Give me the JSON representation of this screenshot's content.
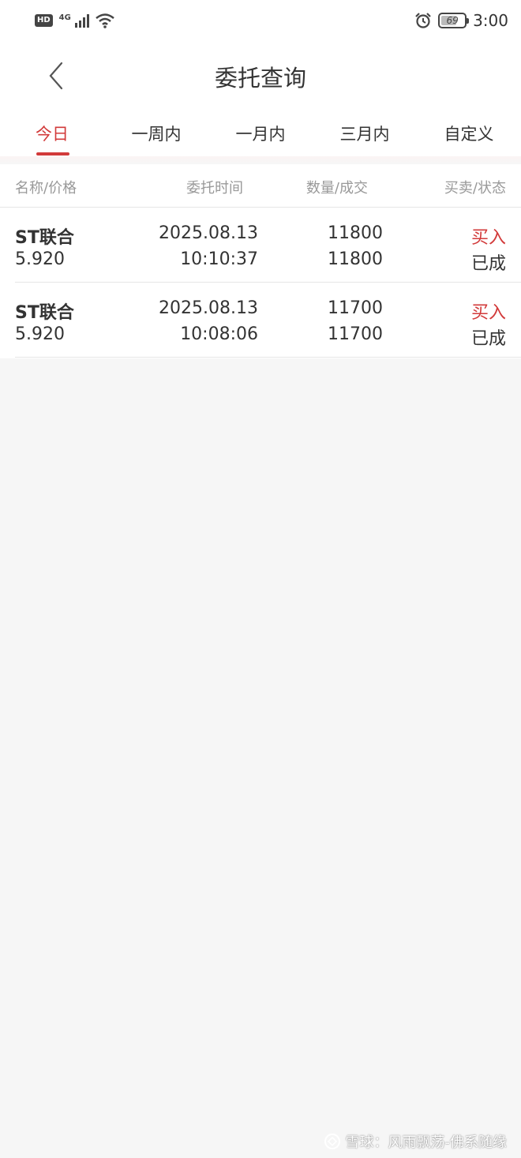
{
  "status_bar": {
    "hd": "HD",
    "network": "4G",
    "battery": "69",
    "battery_level_percent": 69,
    "time": "3:00",
    "icons": [
      "signal-icon",
      "wifi-icon",
      "alarm-icon",
      "battery-icon"
    ]
  },
  "header": {
    "title": "委托查询",
    "back_icon": "chevron-left-icon"
  },
  "tabs": [
    {
      "label": "今日",
      "active": true
    },
    {
      "label": "一周内",
      "active": false
    },
    {
      "label": "一月内",
      "active": false
    },
    {
      "label": "三月内",
      "active": false
    },
    {
      "label": "自定义",
      "active": false
    }
  ],
  "columns": {
    "name_price": "名称/价格",
    "time": "委托时间",
    "qty": "数量/成交",
    "side_status": "买卖/状态"
  },
  "orders": [
    {
      "name": "ST联合",
      "price": "5.920",
      "date": "2025.08.13",
      "time": "10:10:37",
      "qty": "11800",
      "filled": "11800",
      "side": "买入",
      "status": "已成"
    },
    {
      "name": "ST联合",
      "price": "5.920",
      "date": "2025.08.13",
      "time": "10:08:06",
      "qty": "11700",
      "filled": "11700",
      "side": "买入",
      "status": "已成"
    }
  ],
  "watermark": "雪球：风雨飘荡-佛系随缘",
  "colors": {
    "accent": "#d23a3a",
    "background": "#f6f6f6"
  }
}
